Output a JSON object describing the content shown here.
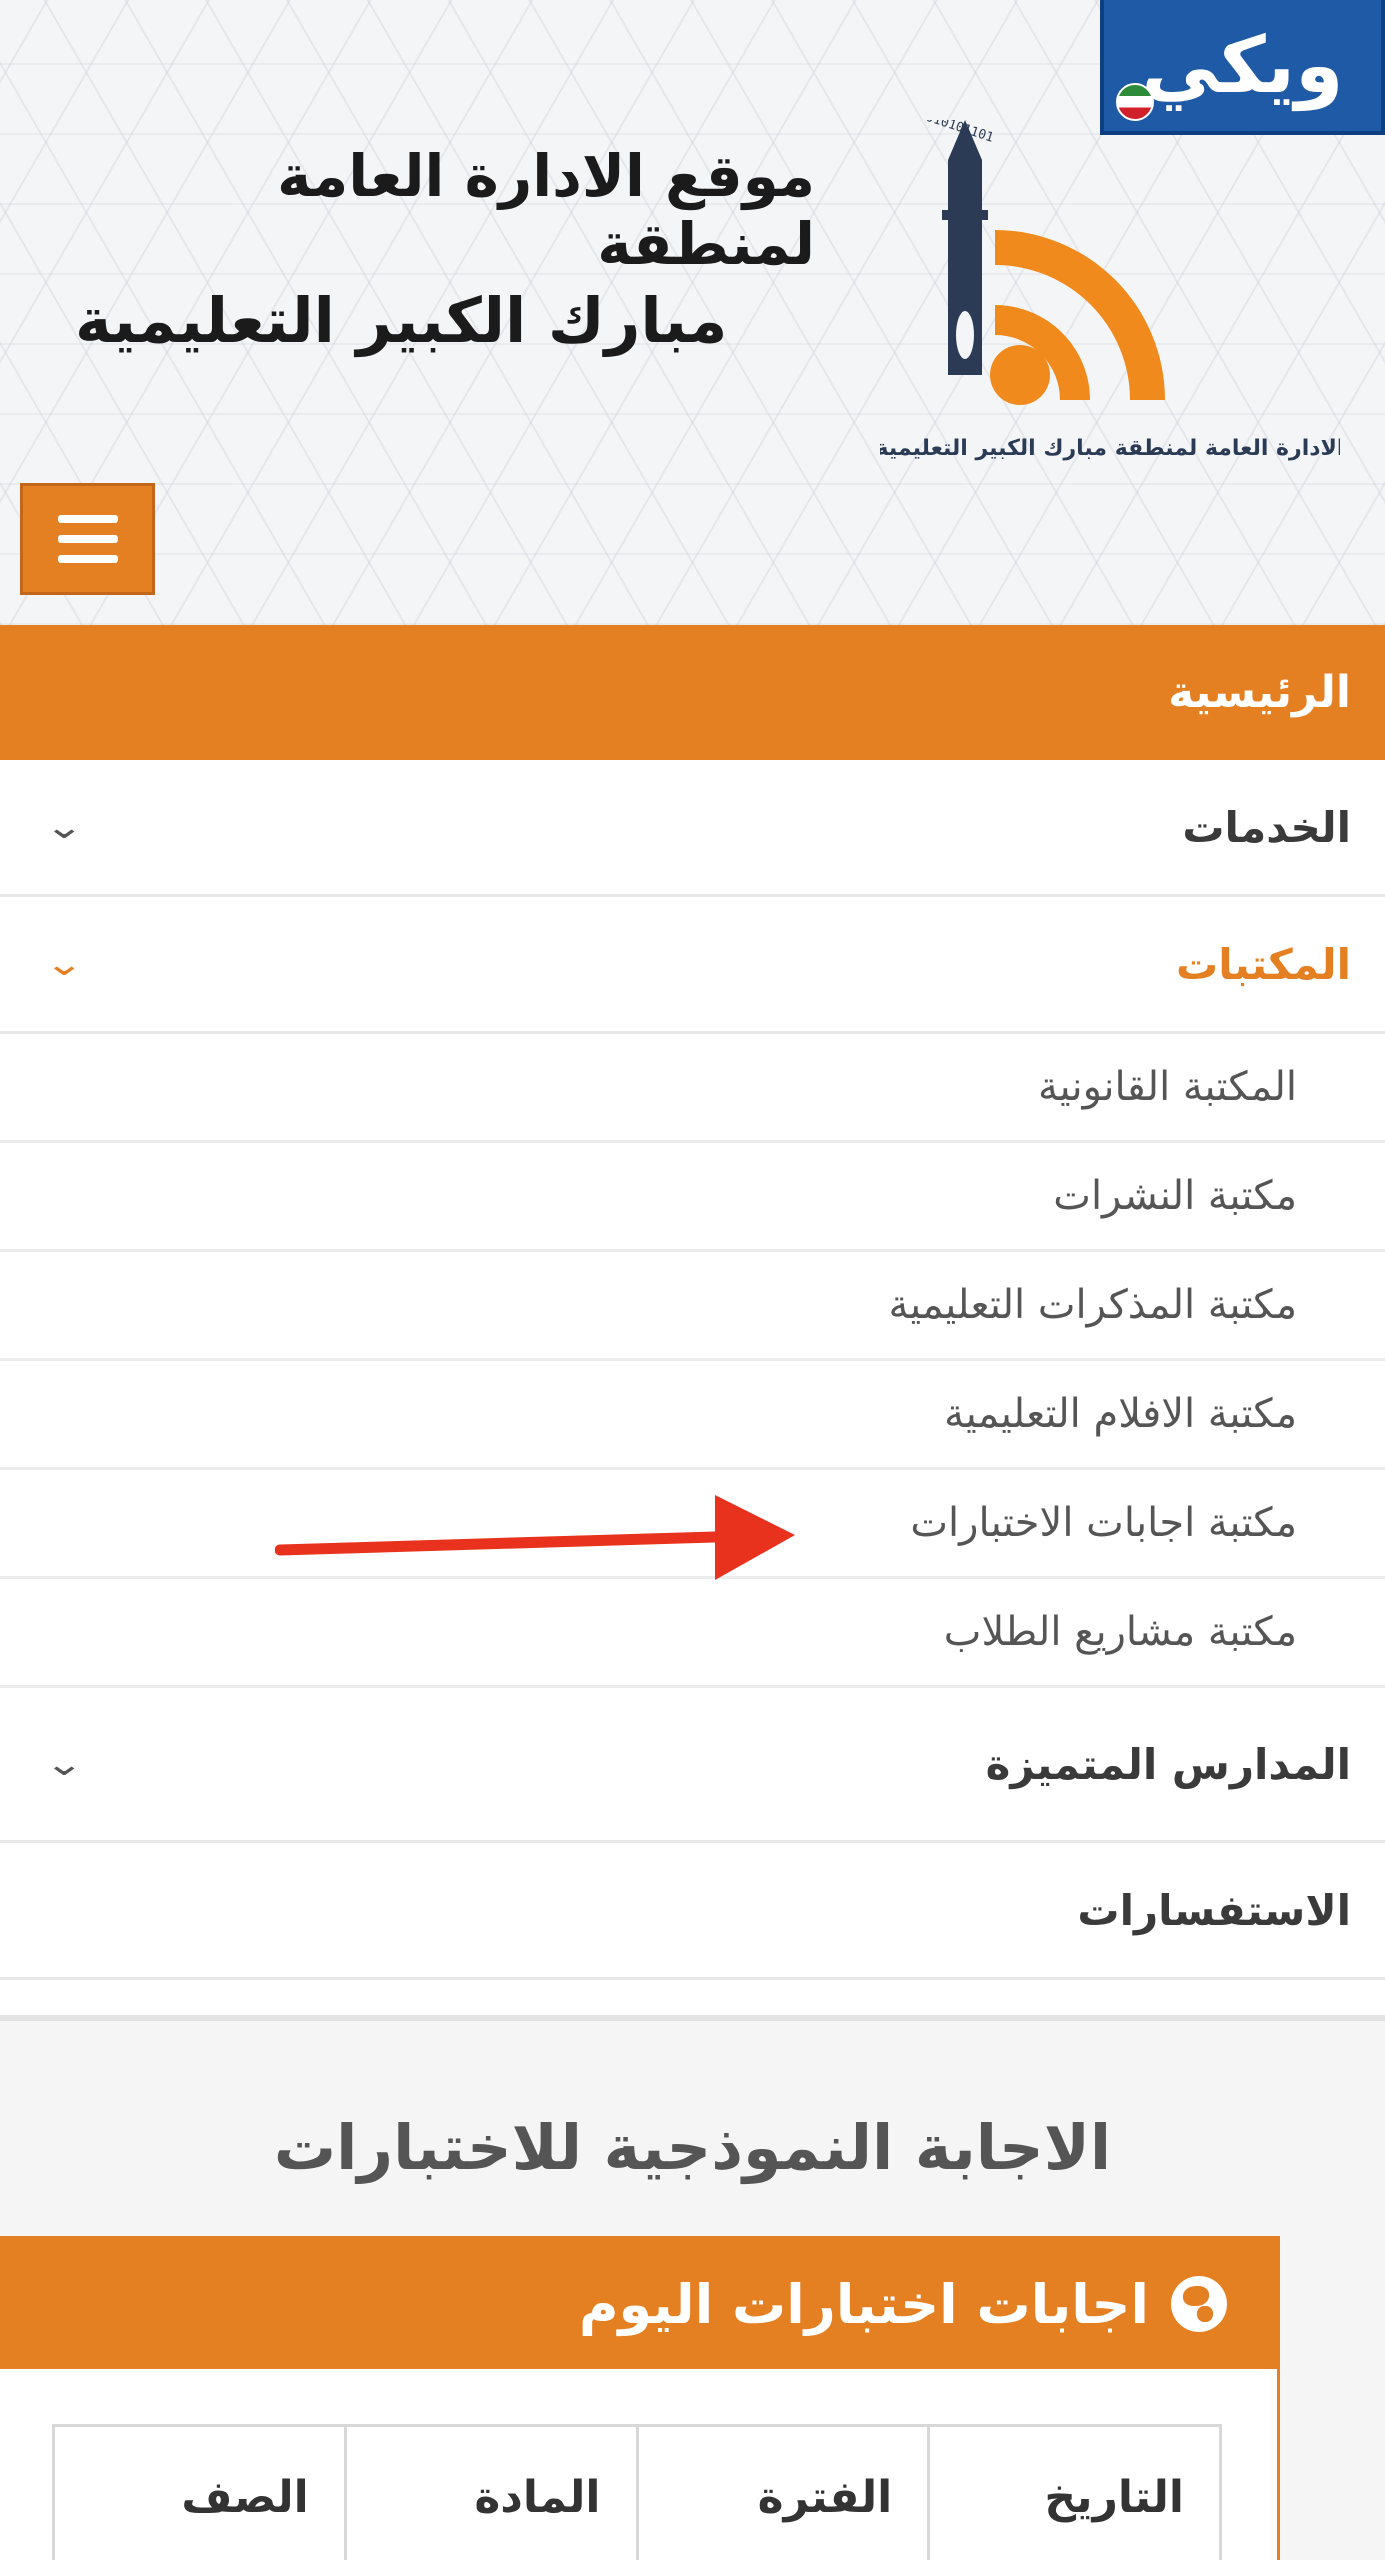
{
  "header": {
    "wiki_badge": "ويكي",
    "title_line1": "موقع الادارة العامة لمنطقة",
    "title_line2": "مبارك الكبير التعليمية",
    "logo_caption": "الادارة العامة لمنطقة مبارك الكبير التعليمية",
    "logo_binary": "1001001001110110010100110101010101101",
    "menu_icon": "hamburger-icon"
  },
  "nav": {
    "home": "الرئيسية",
    "services": "الخدمات",
    "libraries": "المكتبات",
    "sub_items": [
      "المكتبة القانونية",
      "مكتبة النشرات",
      "مكتبة المذكرات التعليمية",
      "مكتبة الافلام التعليمية",
      "مكتبة اجابات الاختبارات",
      "مكتبة مشاريع الطلاب"
    ],
    "schools": "المدارس المتميزة",
    "inquiries": "الاستفسارات"
  },
  "content": {
    "page_title": "الاجابة النموذجية للاختبارات",
    "panel_title": "اجابات اختبارات اليوم",
    "panel_icon": "globe-icon",
    "table_headers": [
      "التاريخ",
      "الفترة",
      "المادة",
      "الصف"
    ]
  },
  "colors": {
    "accent": "#e47f22",
    "wiki_blue": "#1f5aa6",
    "logo_navy": "#2b3a55",
    "arrow_red": "#e8321e"
  }
}
